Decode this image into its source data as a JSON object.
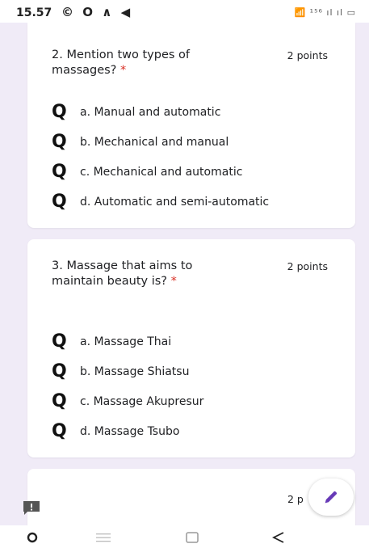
{
  "status_bar": {
    "time": "15.57",
    "left_icons": "© O ∧ ◀",
    "right_icons": "📶 ¹⁵⁶ ıl ıl ▭"
  },
  "questions": [
    {
      "title": "2. Mention two types of massages?",
      "required_mark": "*",
      "points": "2 points",
      "options": [
        {
          "label": "a. Manual and automatic",
          "icon": "Q"
        },
        {
          "label": "b. Mechanical and manual",
          "icon": "Q"
        },
        {
          "label": "c. Mechanical and automatic",
          "icon": "Q"
        },
        {
          "label": "d. Automatic and semi-automatic",
          "icon": "Q"
        }
      ]
    },
    {
      "title": "3. Massage that aims to maintain beauty is?",
      "required_mark": "*",
      "points": "2 points",
      "options": [
        {
          "label": "a. Massage Thai",
          "icon": "Q"
        },
        {
          "label": "b. Massage Shiatsu",
          "icon": "Q"
        },
        {
          "label": "c. Massage Akupresur",
          "icon": "Q"
        },
        {
          "label": "d. Massage Tsubo",
          "icon": "Q"
        }
      ]
    }
  ],
  "partial_card": {
    "points": "2 p"
  },
  "icons": {
    "edit": "pencil-icon",
    "feedback": "feedback-icon"
  },
  "colors": {
    "background": "#f0ebf7",
    "required": "#d93025",
    "accent": "#673ab7"
  }
}
